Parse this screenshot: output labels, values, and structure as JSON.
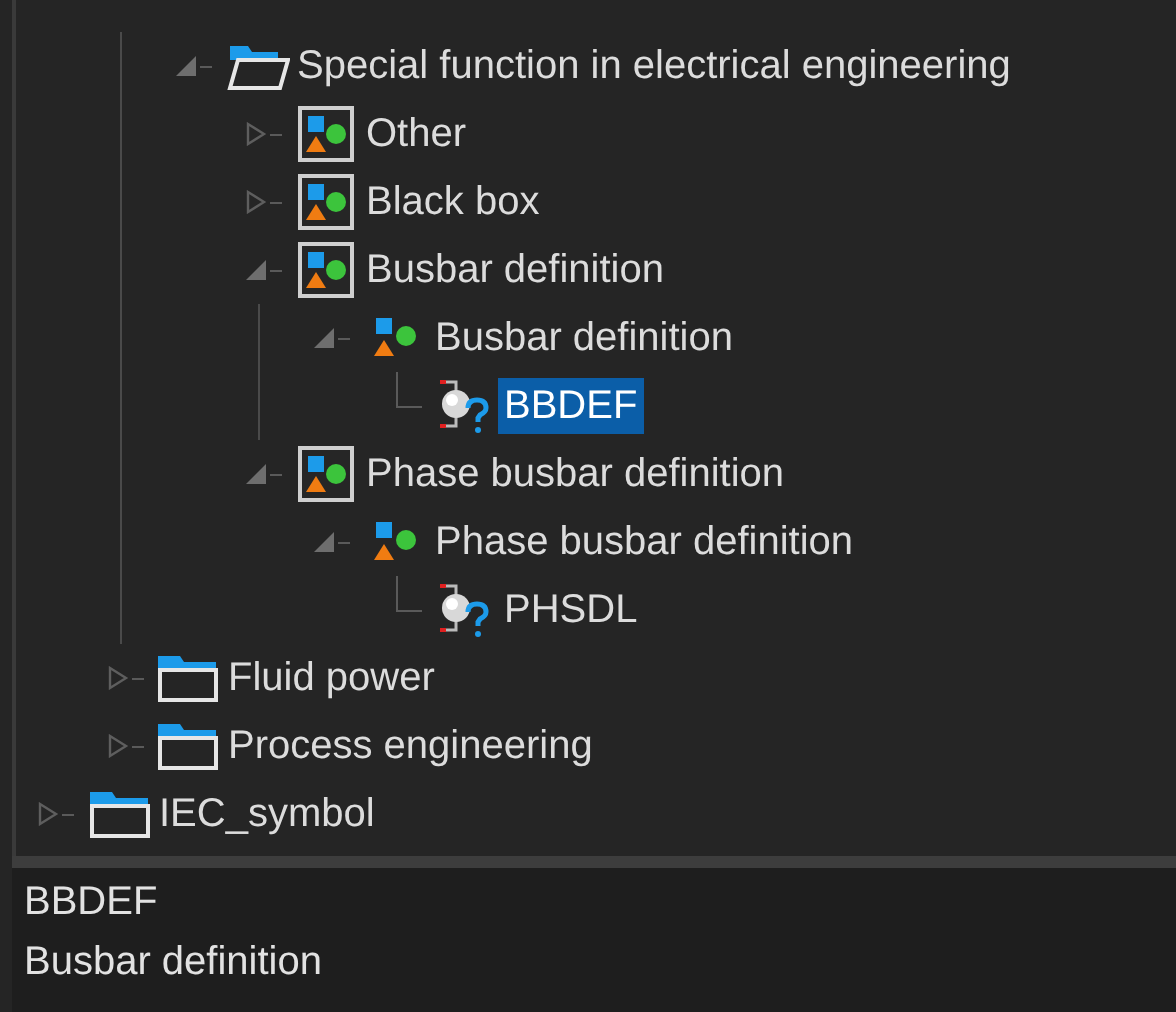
{
  "tree": [
    {
      "children": [
        {
          "children": [
            {
              "label": "Special function in electrical engineering",
              "kind": "folder",
              "expanded": true,
              "selected": false,
              "children": [
                {
                  "label": "Other",
                  "kind": "group",
                  "expanded": false,
                  "selected": false
                },
                {
                  "label": "Black box",
                  "kind": "group",
                  "expanded": false,
                  "selected": false
                },
                {
                  "label": "Busbar definition",
                  "kind": "group",
                  "expanded": true,
                  "selected": false,
                  "children": [
                    {
                      "label": "Busbar definition",
                      "kind": "subgroup",
                      "expanded": true,
                      "selected": false,
                      "children": [
                        {
                          "label": "BBDEF",
                          "kind": "symbol",
                          "selected": true
                        }
                      ]
                    }
                  ]
                },
                {
                  "label": "Phase busbar definition",
                  "kind": "group",
                  "expanded": true,
                  "selected": false,
                  "children": [
                    {
                      "label": "Phase busbar definition",
                      "kind": "subgroup",
                      "expanded": true,
                      "selected": false,
                      "children": [
                        {
                          "label": "PHSDL",
                          "kind": "symbol",
                          "selected": false
                        }
                      ]
                    }
                  ]
                }
              ]
            }
          ]
        },
        {
          "label": "Fluid power",
          "kind": "folder",
          "expanded": false,
          "selected": false
        },
        {
          "label": "Process engineering",
          "kind": "folder",
          "expanded": false,
          "selected": false
        }
      ]
    },
    {
      "label": "IEC_symbol",
      "kind": "folder",
      "expanded": false,
      "selected": false
    }
  ],
  "details": [
    "BBDEF",
    "Busbar definition"
  ]
}
